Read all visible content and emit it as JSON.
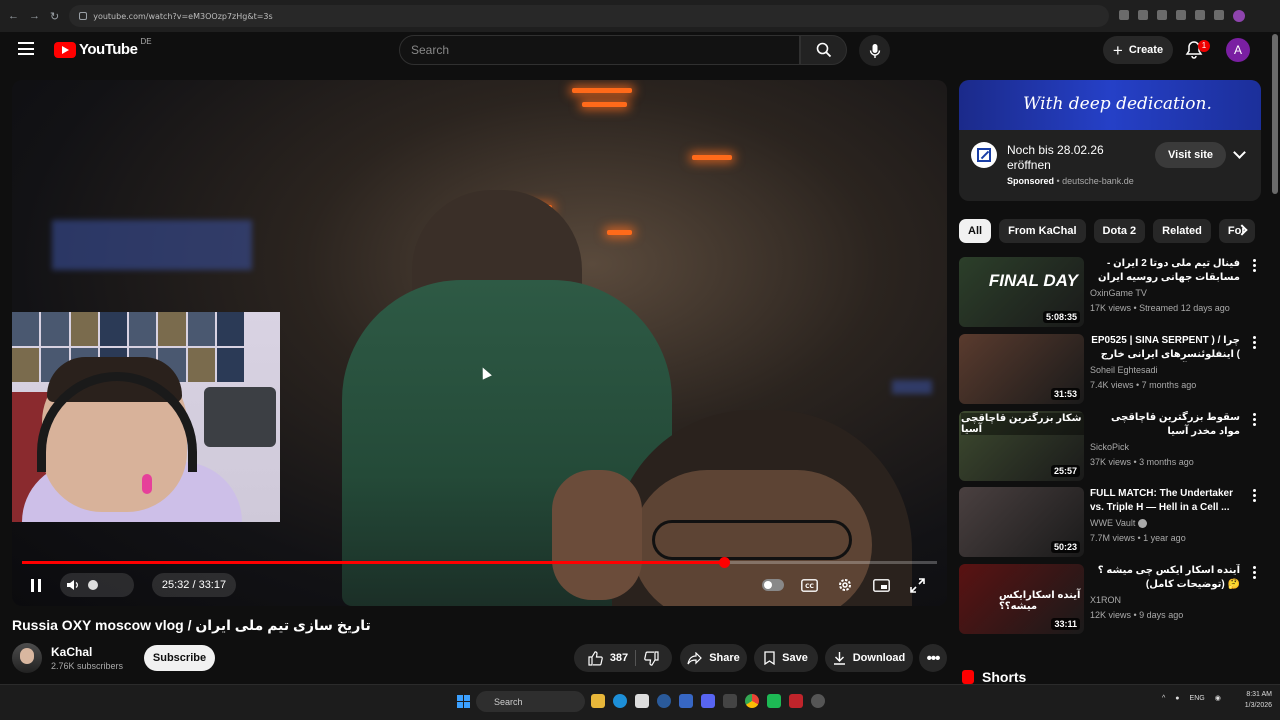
{
  "browser": {
    "url": "youtube.com/watch?v=eM3OOzp7zHg&t=3s"
  },
  "header": {
    "logo_text": "YouTube",
    "region": "DE",
    "search_placeholder": "Search",
    "create_label": "Create",
    "notification_count": "1",
    "avatar_letter": "A"
  },
  "player": {
    "current_time": "25:32",
    "duration": "33:17",
    "time_display": "25:32 / 33:17",
    "progress_fraction": 0.767,
    "playing": true
  },
  "video": {
    "title": "Russia OXY moscow vlog / تاریخ سازی تیم ملی ایران",
    "channel_name": "KaChal",
    "subscribers": "2.76K subscribers",
    "subscribe_label": "Subscribe",
    "likes": "387",
    "share_label": "Share",
    "save_label": "Save",
    "download_label": "Download"
  },
  "ad": {
    "banner_text": "With deep dedication.",
    "title": "Noch bis 28.02.26 eröffnen",
    "sponsored_label": "Sponsored",
    "domain": "deutsche-bank.de",
    "visit_label": "Visit site"
  },
  "chips": [
    {
      "label": "All",
      "active": true
    },
    {
      "label": "From KaChal",
      "active": false
    },
    {
      "label": "Dota 2",
      "active": false
    },
    {
      "label": "Related",
      "active": false
    },
    {
      "label": "For",
      "active": false
    }
  ],
  "recommendations": [
    {
      "title": "فینال تیم ملی دوتا 2 ایران - مسابقات جهانی روسیه ایران قزاقستان",
      "channel": "OxinGame TV",
      "meta": "17K views • Streamed 12 days ago",
      "duration": "5:08:35",
      "thumb_text": "FINAL DAY",
      "thumb_color": "#2c3f2a"
    },
    {
      "title": "چرا / ( EP0525 | SINA SERPENT ) اینفلوئنسرهای ایرانی خارج از کشور درآمدی",
      "channel": "Soheil Eghtesadi",
      "meta": "7.4K views • 7 months ago",
      "duration": "31:53",
      "thumb_text": "",
      "thumb_color": "#5a3b2e"
    },
    {
      "title": "سقوط بزرگترین قاچاقچی مواد مخدر آسیا",
      "channel": "SickoPick",
      "meta": "37K views • 3 months ago",
      "duration": "25:57",
      "thumb_text": "شکار بزرگترین قاچاقچی آسیا",
      "thumb_color": "#3d4a2f"
    },
    {
      "title": "FULL MATCH: The Undertaker vs. Triple H — Hell in a Cell ...",
      "channel": "WWE Vault",
      "meta": "7.7M views • 1 year ago",
      "duration": "50:23",
      "thumb_text": "",
      "thumb_color": "#4a4040",
      "verified": true
    },
    {
      "title": "آینده اسکار ایکس چی میشه ؟ 🤔 (توضیحات کامل)",
      "channel": "X1RON",
      "meta": "12K views • 9 days ago",
      "duration": "33:11",
      "thumb_text": "آینده اسکارایکس میشه؟؟",
      "thumb_color": "#5a1212"
    }
  ],
  "shorts_label": "Shorts",
  "taskbar": {
    "search_label": "Search",
    "lang": "ENG",
    "time": "8:31 AM",
    "date": "1/3/2026"
  },
  "colors": {
    "accent": "#ff0000",
    "background": "#0f0f0f",
    "pill": "#272727"
  }
}
